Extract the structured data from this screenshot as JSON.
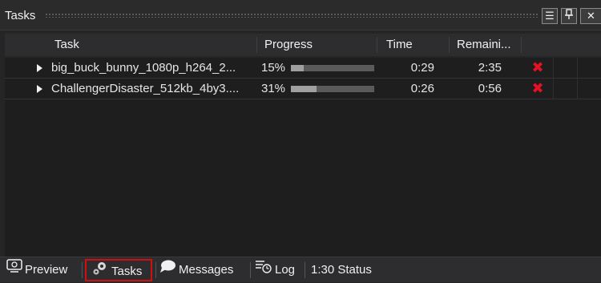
{
  "panel": {
    "title": "Tasks",
    "menu_glyph": "☰",
    "pin_glyph": "🖈",
    "close_glyph": "✕"
  },
  "columns": {
    "task": "Task",
    "progress": "Progress",
    "time": "Time",
    "remaining": "Remaini..."
  },
  "tasks": [
    {
      "name": "big_buck_bunny_1080p_h264_2...",
      "progress_label": "15%",
      "progress_fraction": 0.15,
      "time": "0:29",
      "remaining": "2:35",
      "cancel_glyph": "✖"
    },
    {
      "name": "ChallengerDisaster_512kb_4by3....",
      "progress_label": "31%",
      "progress_fraction": 0.31,
      "time": "0:26",
      "remaining": "0:56",
      "cancel_glyph": "✖"
    }
  ],
  "tabs": [
    {
      "label": "Preview",
      "icon": "monitor-icon"
    },
    {
      "label": "Tasks",
      "icon": "gears-icon",
      "active": true
    },
    {
      "label": "Messages",
      "icon": "speech-bubble-icon"
    },
    {
      "label": "Log",
      "icon": "log-icon"
    },
    {
      "label": "1:30 Status",
      "icon": ""
    }
  ],
  "colors": {
    "cancel": "#e81123",
    "active_tab_border": "#d01010",
    "progress_fill": "#a0a0a0"
  }
}
